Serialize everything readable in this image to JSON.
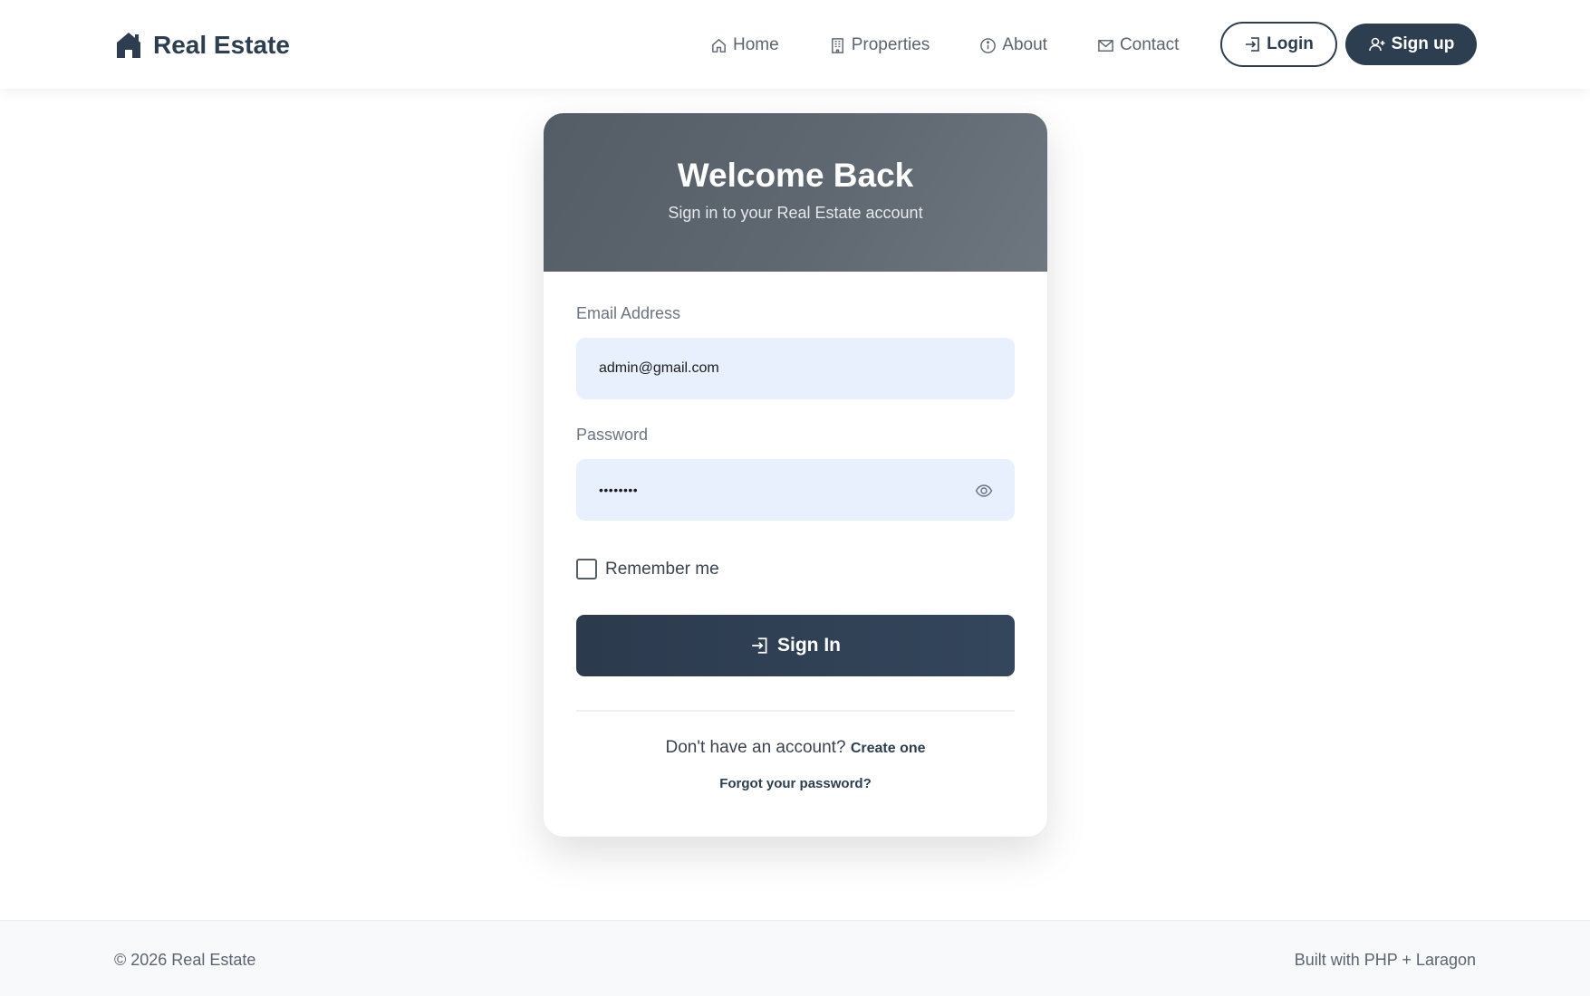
{
  "navbar": {
    "brand": "Real Estate",
    "links": [
      {
        "label": "Home",
        "icon": "home-icon"
      },
      {
        "label": "Properties",
        "icon": "building-icon"
      },
      {
        "label": "About",
        "icon": "info-icon"
      },
      {
        "label": "Contact",
        "icon": "envelope-icon"
      }
    ],
    "login_label": "Login",
    "signup_label": "Sign up"
  },
  "card": {
    "title": "Welcome Back",
    "subtitle": "Sign in to your Real Estate account",
    "email_label": "Email Address",
    "email_value": "admin@gmail.com",
    "password_label": "Password",
    "password_value": "••••••••",
    "remember_label": "Remember me",
    "signin_label": "Sign In",
    "no_account_text": "Don't have an account?",
    "create_link": "Create one",
    "forgot_link": "Forgot your password?"
  },
  "footer": {
    "copyright": "© 2026 Real Estate",
    "built_with": "Built with PHP + Laragon"
  },
  "colors": {
    "primary": "#2c3e50",
    "input_bg": "#e8f0fe",
    "header_gradient_start": "#545c66",
    "header_gradient_end": "#6e767f",
    "footer_bg": "#f8f9fa"
  }
}
